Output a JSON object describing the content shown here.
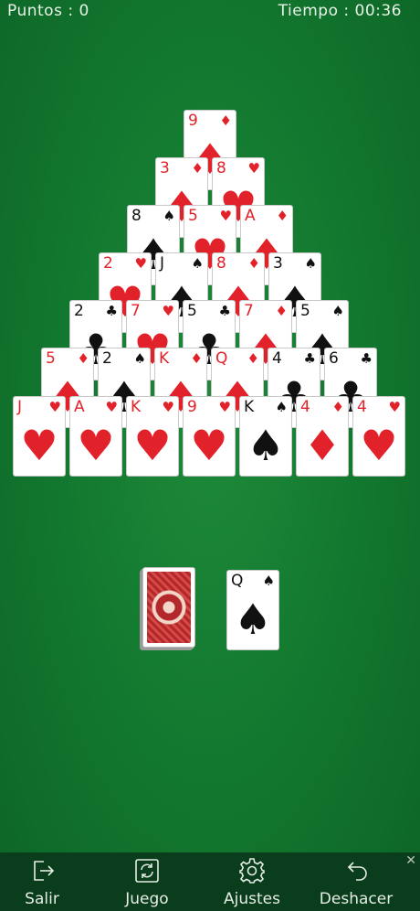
{
  "hud": {
    "score": "Puntos : 0",
    "time": "Tiempo : 00:36"
  },
  "pyramid": [
    [
      {
        "rank": "9",
        "suit": "♦",
        "color": "red"
      }
    ],
    [
      {
        "rank": "3",
        "suit": "♦",
        "color": "red"
      },
      {
        "rank": "8",
        "suit": "♥",
        "color": "red"
      }
    ],
    [
      {
        "rank": "8",
        "suit": "♠",
        "color": "black"
      },
      {
        "rank": "5",
        "suit": "♥",
        "color": "red"
      },
      {
        "rank": "A",
        "suit": "♦",
        "color": "red"
      }
    ],
    [
      {
        "rank": "2",
        "suit": "♥",
        "color": "red"
      },
      {
        "rank": "J",
        "suit": "♠",
        "color": "black"
      },
      {
        "rank": "8",
        "suit": "♦",
        "color": "red"
      },
      {
        "rank": "3",
        "suit": "♠",
        "color": "black"
      }
    ],
    [
      {
        "rank": "2",
        "suit": "♣",
        "color": "black"
      },
      {
        "rank": "7",
        "suit": "♥",
        "color": "red"
      },
      {
        "rank": "5",
        "suit": "♣",
        "color": "black"
      },
      {
        "rank": "7",
        "suit": "♦",
        "color": "red"
      },
      {
        "rank": "5",
        "suit": "♠",
        "color": "black"
      }
    ],
    [
      {
        "rank": "5",
        "suit": "♦",
        "color": "red"
      },
      {
        "rank": "2",
        "suit": "♠",
        "color": "black"
      },
      {
        "rank": "K",
        "suit": "♦",
        "color": "red"
      },
      {
        "rank": "Q",
        "suit": "♦",
        "color": "red"
      },
      {
        "rank": "4",
        "suit": "♣",
        "color": "black"
      },
      {
        "rank": "6",
        "suit": "♣",
        "color": "black"
      }
    ],
    [
      {
        "rank": "J",
        "suit": "♥",
        "color": "red"
      },
      {
        "rank": "A",
        "suit": "♥",
        "color": "red"
      },
      {
        "rank": "K",
        "suit": "♥",
        "color": "red"
      },
      {
        "rank": "9",
        "suit": "♥",
        "color": "red"
      },
      {
        "rank": "K",
        "suit": "♠",
        "color": "black"
      },
      {
        "rank": "4",
        "suit": "♦",
        "color": "red"
      },
      {
        "rank": "4",
        "suit": "♥",
        "color": "red"
      }
    ]
  ],
  "waste": {
    "rank": "Q",
    "suit": "♠",
    "color": "black"
  },
  "nav": {
    "exit": "Salir",
    "game": "Juego",
    "settings": "Ajustes",
    "undo": "Deshacer",
    "close": "✕"
  }
}
